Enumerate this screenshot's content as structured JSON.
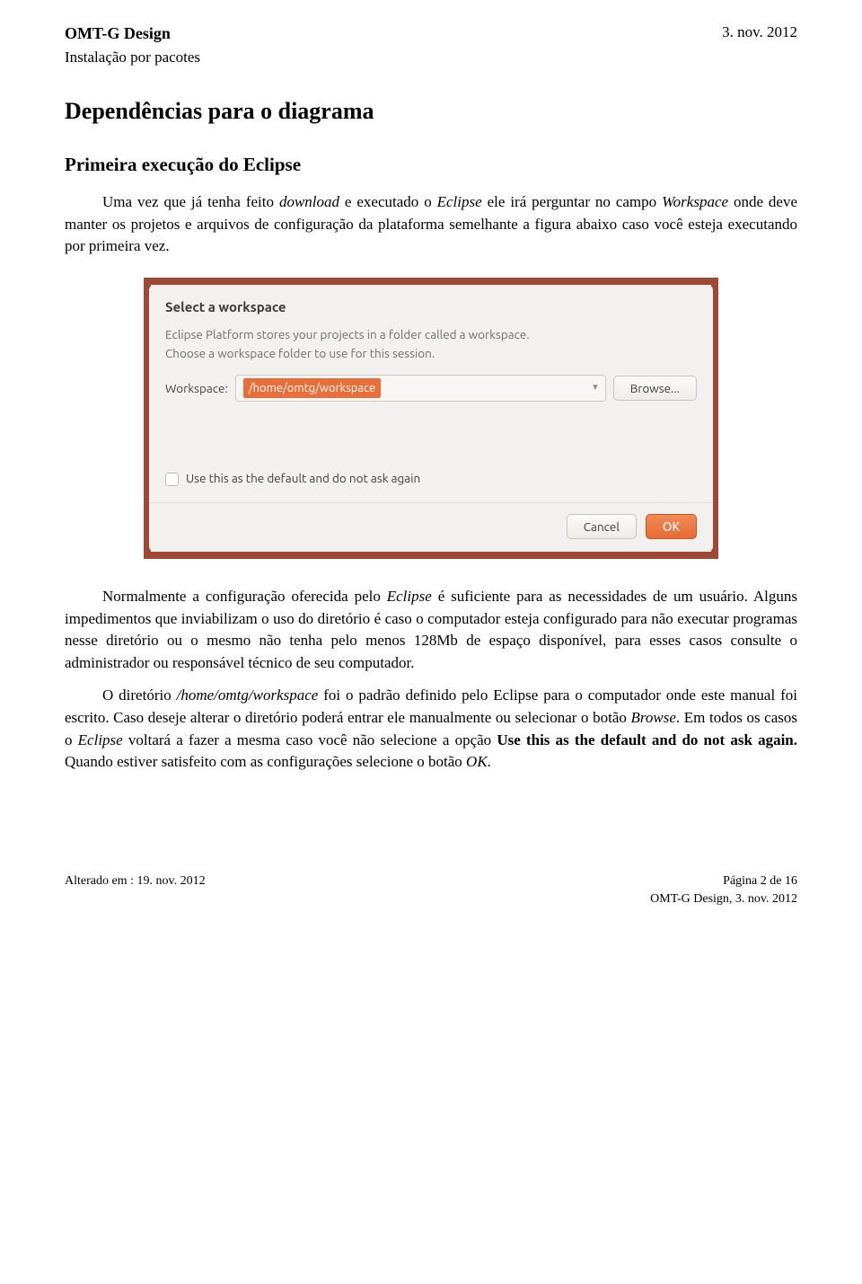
{
  "header": {
    "title": "OMT-G Design",
    "date": "3. nov. 2012",
    "subtitle": "Instalação por pacotes"
  },
  "h1": "Dependências para o diagrama",
  "h2": "Primeira execução do Eclipse",
  "para1_a": "Uma vez que já tenha feito ",
  "para1_download": "download",
  "para1_b": " e executado o ",
  "para1_eclipse": "Eclipse",
  "para1_c": " ele irá perguntar no campo ",
  "para1_workspace": "Workspace",
  "para1_d": " onde deve manter os projetos e arquivos de configuração da plataforma semelhante a figura abaixo caso você esteja executando por primeira vez.",
  "dialog": {
    "title": "Select a workspace",
    "desc1": "Eclipse Platform stores your projects in a folder called a workspace.",
    "desc2": "Choose a workspace folder to use for this session.",
    "ws_label": "Workspace:",
    "ws_value": "/home/omtg/workspace",
    "browse": "Browse...",
    "checkbox_label": "Use this as the default and do not ask again",
    "cancel": "Cancel",
    "ok": "OK"
  },
  "para2_a": "Normalmente a configuração oferecida pelo ",
  "para2_eclipse": "Eclipse",
  "para2_b": " é suficiente para as necessidades de um usuário. Alguns impedimentos que inviabilizam o uso do diretório é caso o computador esteja configurado para não executar programas nesse diretório ou o mesmo não tenha pelo menos 128Mb de espaço disponível, para esses casos consulte o administrador ou responsável técnico de seu computador.",
  "para3_a": "O diretório ",
  "para3_path": "/home/omtg/workspace",
  "para3_b": " foi o padrão definido pelo Eclipse para o computador onde este manual foi escrito. Caso deseje alterar o diretório poderá entrar ele manualmente ou selecionar o botão ",
  "para3_browse": "Browse",
  "para3_c": ". Em todos os casos o ",
  "para3_eclipse": "Eclipse",
  "para3_d": " voltará a fazer a mesma caso você não selecione a opção ",
  "para3_option": "Use this as the default and do not ask again.",
  "para3_e": " Quando estiver satisfeito com as configurações selecione o botão ",
  "para3_ok": "OK",
  "para3_f": ".",
  "footer": {
    "left": "Alterado em : 19. nov. 2012",
    "right1": "Página 2 de 16",
    "right2": "OMT-G Design, 3. nov. 2012"
  }
}
